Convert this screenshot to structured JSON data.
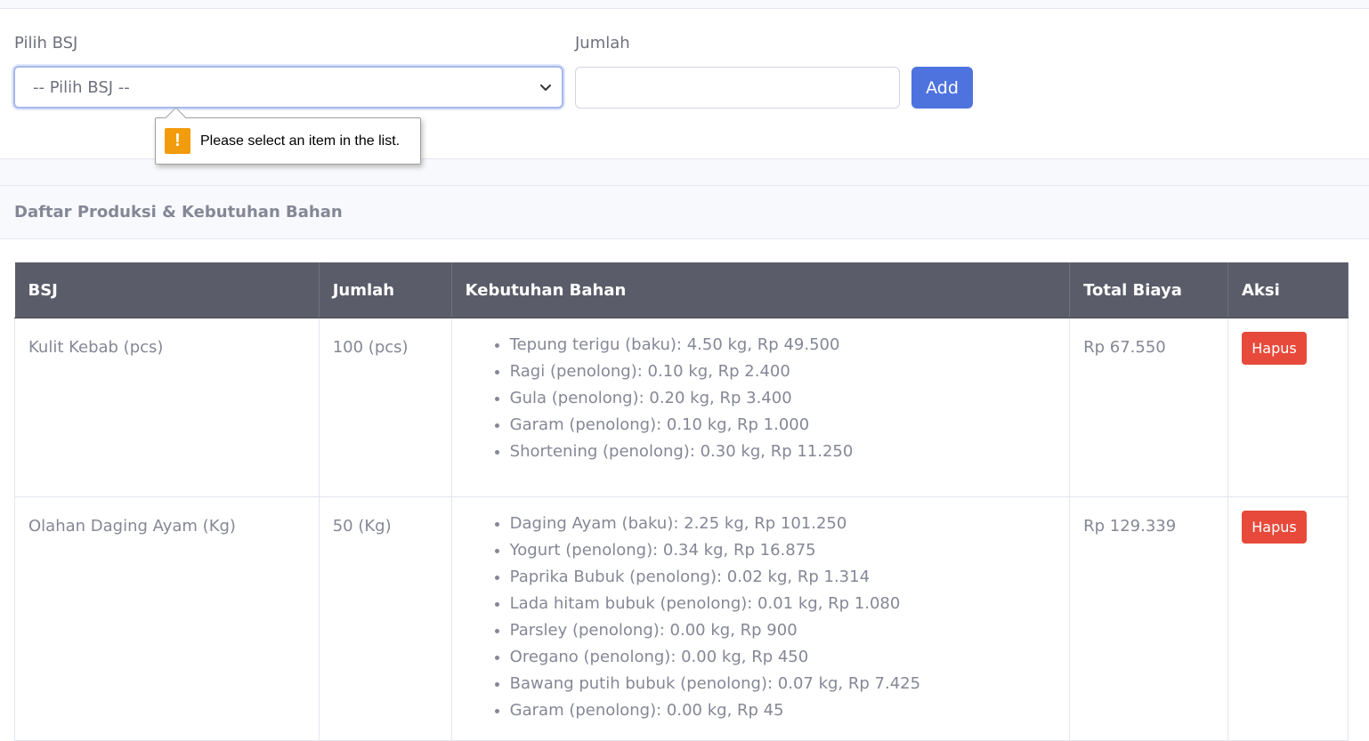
{
  "form": {
    "bsj_label": "Pilih BSJ",
    "bsj_selected": "-- Pilih BSJ --",
    "jumlah_label": "Jumlah",
    "jumlah_value": "",
    "add_label": "Add"
  },
  "tooltip": {
    "icon": "!",
    "text": "Please select an item in the list."
  },
  "card": {
    "title": "Daftar Produksi & Kebutuhan Bahan"
  },
  "table": {
    "headers": [
      "BSJ",
      "Jumlah",
      "Kebutuhan Bahan",
      "Total Biaya",
      "Aksi"
    ],
    "rows": [
      {
        "bsj": "Kulit Kebab (pcs)",
        "jumlah": "100 (pcs)",
        "bahan": [
          "Tepung terigu (baku): 4.50 kg, Rp 49.500",
          "Ragi (penolong): 0.10 kg, Rp 2.400",
          "Gula (penolong): 0.20 kg, Rp 3.400",
          "Garam (penolong): 0.10 kg, Rp 1.000",
          "Shortening (penolong): 0.30 kg, Rp 11.250"
        ],
        "total": "Rp 67.550",
        "aksi": "Hapus"
      },
      {
        "bsj": "Olahan Daging Ayam (Kg)",
        "jumlah": "50 (Kg)",
        "bahan": [
          "Daging Ayam (baku): 2.25 kg, Rp 101.250",
          "Yogurt (penolong): 0.34 kg, Rp 16.875",
          "Paprika Bubuk (penolong): 0.02 kg, Rp 1.314",
          "Lada hitam bubuk (penolong): 0.01 kg, Rp 1.080",
          "Parsley (penolong): 0.00 kg, Rp 900",
          "Oregano (penolong): 0.00 kg, Rp 450",
          "Bawang putih bubuk (penolong): 0.07 kg, Rp 7.425",
          "Garam (penolong): 0.00 kg, Rp 45"
        ],
        "total": "Rp 129.339",
        "aksi": "Hapus"
      }
    ]
  },
  "colors": {
    "primary": "#4e73df",
    "danger": "#e74a3b",
    "table_header": "#5a5c69",
    "warning": "#f29b0c",
    "text": "#858796"
  }
}
